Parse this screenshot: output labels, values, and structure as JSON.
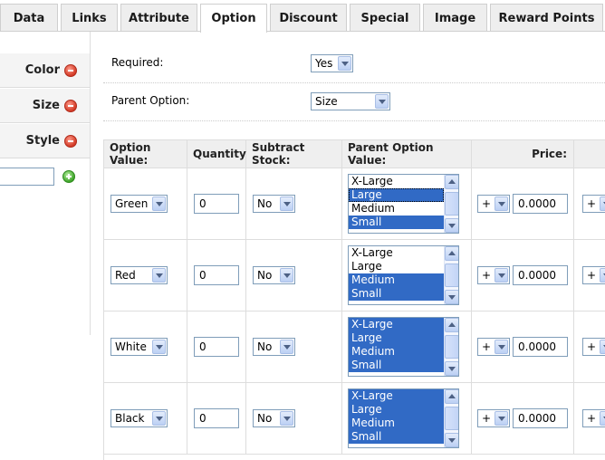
{
  "tabs": [
    {
      "label": "Data"
    },
    {
      "label": "Links"
    },
    {
      "label": "Attribute"
    },
    {
      "label": "Option",
      "active": true
    },
    {
      "label": "Discount"
    },
    {
      "label": "Special"
    },
    {
      "label": "Image"
    },
    {
      "label": "Reward Points"
    }
  ],
  "options_list": [
    {
      "label": "Color"
    },
    {
      "label": "Size"
    },
    {
      "label": "Style"
    }
  ],
  "new_option": {
    "value": ""
  },
  "form": {
    "required_label": "Required:",
    "required_value": "Yes",
    "parent_label": "Parent Option:",
    "parent_value": "Size"
  },
  "table": {
    "headers": {
      "option_value": "Option Value:",
      "quantity": "Quantity:",
      "subtract": "Subtract Stock:",
      "parent_value": "Parent Option Value:",
      "price": "Price:"
    },
    "rows": [
      {
        "value": "Green",
        "quantity": "0",
        "subtract": "No",
        "price_prefix": "+",
        "price": "0.0000",
        "next_prefix": "+",
        "parents": [
          {
            "label": "X-Large",
            "selected": false
          },
          {
            "label": "Large",
            "selected": true
          },
          {
            "label": "Medium",
            "selected": false
          },
          {
            "label": "Small",
            "selected": true
          }
        ]
      },
      {
        "value": "Red",
        "quantity": "0",
        "subtract": "No",
        "price_prefix": "+",
        "price": "0.0000",
        "next_prefix": "+",
        "parents": [
          {
            "label": "X-Large",
            "selected": false
          },
          {
            "label": "Large",
            "selected": false
          },
          {
            "label": "Medium",
            "selected": true
          },
          {
            "label": "Small",
            "selected": true
          }
        ]
      },
      {
        "value": "White",
        "quantity": "0",
        "subtract": "No",
        "price_prefix": "+",
        "price": "0.0000",
        "next_prefix": "+",
        "parents": [
          {
            "label": "X-Large",
            "selected": true
          },
          {
            "label": "Large",
            "selected": true
          },
          {
            "label": "Medium",
            "selected": true
          },
          {
            "label": "Small",
            "selected": true
          }
        ]
      },
      {
        "value": "Black",
        "quantity": "0",
        "subtract": "No",
        "price_prefix": "+",
        "price": "0.0000",
        "next_prefix": "+",
        "parents": [
          {
            "label": "X-Large",
            "selected": true
          },
          {
            "label": "Large",
            "selected": true
          },
          {
            "label": "Medium",
            "selected": true
          },
          {
            "label": "Small",
            "selected": true
          }
        ]
      }
    ]
  },
  "colors": {
    "selection": "#316ac5",
    "header_bg": "#efefef",
    "tab_bg": "#eeeeee",
    "remove_icon": "#d23a26",
    "add_icon": "#3fa52a"
  },
  "icons": {
    "remove": "remove-circle-icon",
    "add": "add-circle-icon",
    "dropdown": "chevron-down-icon"
  }
}
